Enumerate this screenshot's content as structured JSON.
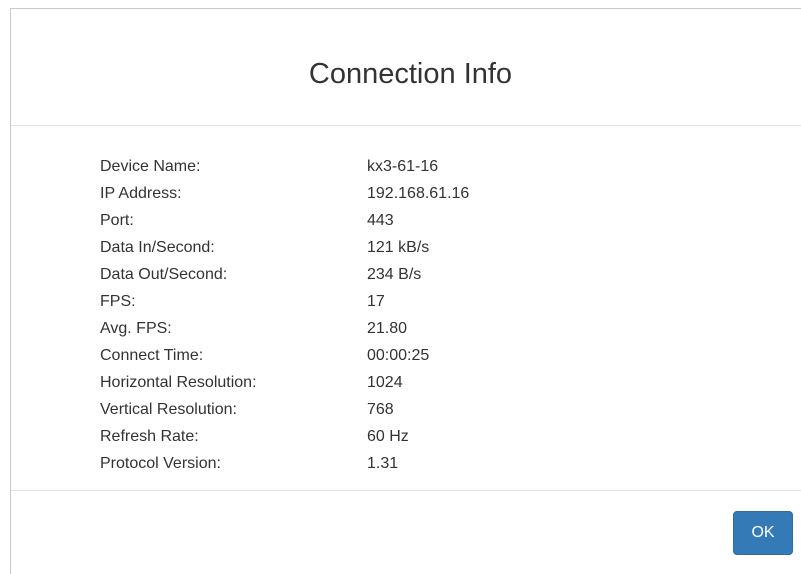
{
  "dialog": {
    "title": "Connection Info",
    "ok_label": "OK"
  },
  "rows": [
    {
      "label": "Device Name:",
      "value": "kx3-61-16"
    },
    {
      "label": "IP Address:",
      "value": "192.168.61.16"
    },
    {
      "label": "Port:",
      "value": "443"
    },
    {
      "label": "Data In/Second:",
      "value": "121 kB/s"
    },
    {
      "label": "Data Out/Second:",
      "value": "234 B/s"
    },
    {
      "label": "FPS:",
      "value": "17"
    },
    {
      "label": "Avg. FPS:",
      "value": "21.80"
    },
    {
      "label": "Connect Time:",
      "value": "00:00:25"
    },
    {
      "label": "Horizontal Resolution:",
      "value": "1024"
    },
    {
      "label": "Vertical Resolution:",
      "value": "768"
    },
    {
      "label": "Refresh Rate:",
      "value": "60 Hz"
    },
    {
      "label": "Protocol Version:",
      "value": "1.31"
    }
  ],
  "colors": {
    "primary_button": "#337ab7",
    "text": "#333333",
    "divider": "#e5e5e5"
  }
}
